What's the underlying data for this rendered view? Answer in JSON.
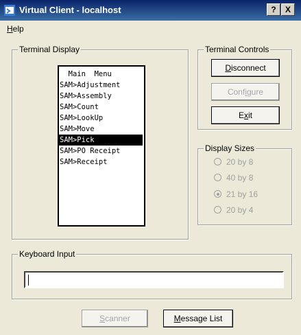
{
  "window": {
    "title": "Virtual Client - localhost",
    "app_icon": "app-window-icon",
    "help_button": "?",
    "close_button": "X"
  },
  "menubar": {
    "items": [
      {
        "label": "Help",
        "underline": "H"
      }
    ]
  },
  "terminal_display": {
    "label": "Terminal Display",
    "lines": [
      "  Main  Menu",
      "SAM>Adjustment",
      "SAM>Assembly",
      "SAM>Count",
      "SAM>LookUp",
      "SAM>Move",
      "SAM>Pick",
      "SAM>PO Receipt",
      "SAM>Receipt"
    ],
    "selected_index": 6
  },
  "terminal_controls": {
    "label": "Terminal Controls",
    "buttons": [
      {
        "label": "Disconnect",
        "enabled": true
      },
      {
        "label": "Configure",
        "enabled": false
      },
      {
        "label": "Exit",
        "enabled": true
      }
    ]
  },
  "display_sizes": {
    "label": "Display Sizes",
    "options": [
      {
        "label": "20 by 8",
        "checked": false
      },
      {
        "label": "40 by 8",
        "checked": false
      },
      {
        "label": "21 by 16",
        "checked": true
      },
      {
        "label": "20 by 4",
        "checked": false
      }
    ],
    "enabled": false
  },
  "keyboard_input": {
    "label": "Keyboard Input",
    "value": ""
  },
  "bottom_buttons": {
    "scanner": {
      "label": "Scanner",
      "enabled": false
    },
    "message_list": {
      "label": "Message List",
      "enabled": true
    }
  },
  "colors": {
    "titlebar": "#0a246a",
    "window_bg": "#ece9d8",
    "disabled_text": "#a0a0a0"
  }
}
